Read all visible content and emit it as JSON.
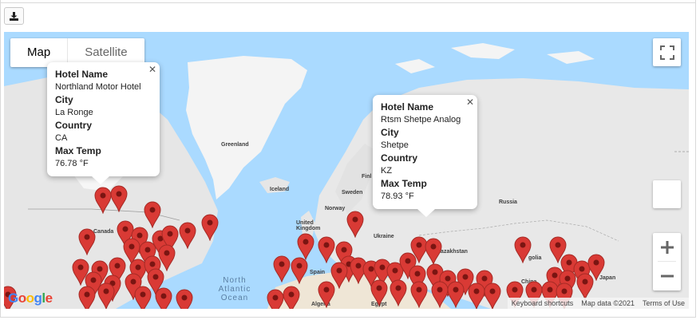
{
  "toolbar": {
    "download_icon": "download-icon"
  },
  "map": {
    "type_control": {
      "map_label": "Map",
      "satellite_label": "Satellite",
      "selected": "Map"
    },
    "labels": {
      "greenland": "Greenland",
      "iceland": "Iceland",
      "finland": "Finl",
      "sweden": "Sweden",
      "norway": "Norway",
      "russia": "Russia",
      "canada": "Canada",
      "united_kingdom": "United Kingdom",
      "ukraine": "Ukraine",
      "kazakhstan": "Kazakhstan",
      "spain": "Spain",
      "algeria": "Algeria",
      "egypt": "Egypt",
      "mongolia": "golia",
      "china": "China",
      "japan": "Japan",
      "ocean": "North Atlantic Ocean"
    },
    "attribution": {
      "shortcuts": "Keyboard shortcuts",
      "map_data": "Map data ©2021",
      "terms": "Terms of Use"
    },
    "logo": "Google",
    "marker_color": "#d93a35"
  },
  "infowindows": [
    {
      "hotel_label": "Hotel Name",
      "hotel": "Northland Motor Hotel",
      "city_label": "City",
      "city": "La Ronge",
      "country_label": "Country",
      "country": "CA",
      "temp_label": "Max Temp",
      "temp": "76.78 °F"
    },
    {
      "hotel_label": "Hotel Name",
      "hotel": "Rtsm Shetpe Analog",
      "city_label": "City",
      "city": "Shetpe",
      "country_label": "Country",
      "country": "KZ",
      "temp_label": "Max Temp",
      "temp": "78.93 °F"
    }
  ]
}
